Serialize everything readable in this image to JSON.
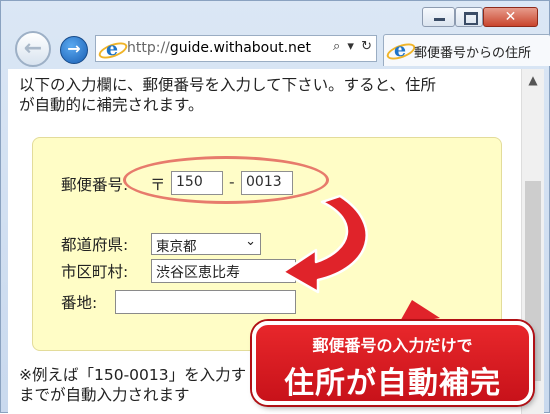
{
  "browser": {
    "url_prefix": "http://",
    "url_host": "guide.withabout.net",
    "search_glyph": "⌕",
    "dropdown_glyph": "▾",
    "refresh_glyph": "↻",
    "tab_title": "郵便番号からの住所",
    "back_glyph": "←",
    "forward_glyph": "→",
    "close_glyph": "✕"
  },
  "page": {
    "intro_line1": "以下の入力欄に、郵便番号を入力して下さい。すると、住所",
    "intro_line2": "が自動的に補完されます。",
    "form": {
      "postal_label": "郵便番号:",
      "postal_mark": "〒",
      "postal_first": "150",
      "postal_dash": "-",
      "postal_second": "0013",
      "prefecture_label": "都道府県:",
      "prefecture_value": "東京都",
      "city_label": "市区町村:",
      "city_value": "渋谷区恵比寿",
      "street_label": "番地:",
      "street_value": ""
    },
    "note_line1": "※例えば「150-0013」を入力す",
    "note_line2": "までが自動入力されます"
  },
  "annotation": {
    "banner_top": "郵便番号の入力だけで",
    "banner_main": "住所が自動補完"
  },
  "colors": {
    "panel_bg": "#fffdc6",
    "annotation_red": "#e0232a",
    "ellipse": "#e77b6c"
  }
}
